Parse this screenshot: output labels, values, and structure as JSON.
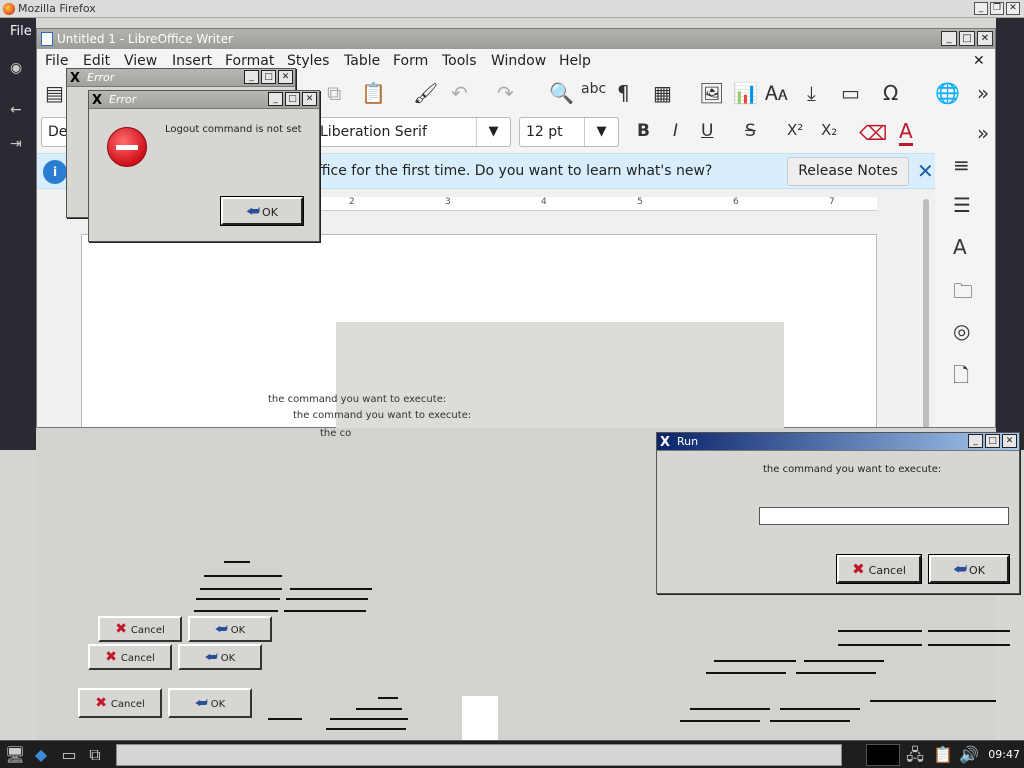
{
  "firefox": {
    "title": "Mozilla Firefox",
    "menu_file": "File"
  },
  "libreoffice": {
    "title": "Untitled 1 - LibreOffice Writer",
    "menu": [
      "File",
      "Edit",
      "View",
      "Insert",
      "Format",
      "Styles",
      "Table",
      "Form",
      "Tools",
      "Window",
      "Help"
    ],
    "paragraph_style": "De",
    "font_name": "Liberation Serif",
    "font_size": "12 pt",
    "infobar_message": "ffice for the first time. Do you want to learn what's new?",
    "release_notes_label": "Release Notes",
    "ruler_marks": [
      "2",
      "3",
      "4",
      "5",
      "6",
      "7"
    ]
  },
  "error_dialog_back": {
    "title": "Error"
  },
  "error_dialog": {
    "title": "Error",
    "message": "Logout command is not set",
    "ok_label": "OK"
  },
  "run_dialog": {
    "title": "Run",
    "prompt": "the command you want to execute:",
    "input_value": "",
    "cancel_label": "Cancel",
    "ok_label": "OK"
  },
  "ghost": {
    "prompt_1": "the command you want to execute:",
    "prompt_2": "the command you want to execute:",
    "prompt_3": "the co",
    "cancel": "Cancel",
    "ok": "OK"
  },
  "taskbar": {
    "clock": "09:47"
  },
  "icons": {
    "close": "✕",
    "minimize": "_",
    "maximize": "□",
    "restore": "❐"
  }
}
